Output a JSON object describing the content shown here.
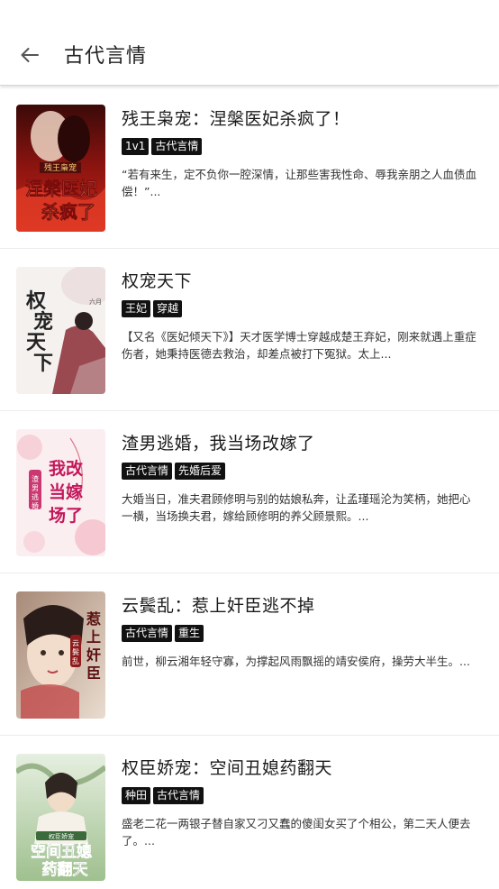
{
  "header": {
    "title": "古代言情",
    "back_icon": "arrow-left-icon"
  },
  "books": [
    {
      "title": "残王枭宠：涅槃医妃杀疯了！",
      "tags": [
        "1v1",
        "古代言情"
      ],
      "description": "“若有来生，定不负你一腔深情，让那些害我性命、辱我亲朋之人血债血偿！”...",
      "cover": {
        "top": "残王枭宠",
        "main": "涅槃医妃",
        "sub": "杀疯了",
        "bg": "#7a0c0c"
      }
    },
    {
      "title": "权宠天下",
      "tags": [
        "王妃",
        "穿越"
      ],
      "description": "【又名《医妃倾天下》】天才医学博士穿越成楚王弃妃，刚来就遇上重症伤者，她秉持医德去救治，却差点被打下冤狱。太上...",
      "cover": {
        "main": "权宠天下",
        "author": "六月",
        "bg": "#f4f1ef"
      }
    },
    {
      "title": "渣男逃婚，我当场改嫁了",
      "tags": [
        "古代言情",
        "先婚后爱"
      ],
      "description": "大婚当日，准夫君顾修明与别的姑娘私奔，让孟瑾瑶沦为笑柄，她把心一横，当场换夫君，嫁给顾修明的养父顾景熙。...",
      "cover": {
        "main": "我当场改嫁了",
        "sub": "渣男逃婚",
        "bg": "#fbeef0"
      }
    },
    {
      "title": "云鬓乱：惹上奸臣逃不掉",
      "tags": [
        "古代言情",
        "重生"
      ],
      "description": "前世，柳云湘年轻守寡，为撑起风雨飘摇的靖安侯府，操劳大半生。...",
      "cover": {
        "main": "惹上奸臣",
        "sub": "云鬓乱",
        "bg": "#d9c6b8"
      }
    },
    {
      "title": "权臣娇宠：空间丑媳药翻天",
      "tags": [
        "种田",
        "古代言情"
      ],
      "description": "盛老二花一两银子替自家又刁又蠢的傻闺女买了个相公，第二天人便去了。...",
      "cover": {
        "main": "空间丑媳",
        "sub": "药翻天",
        "top": "权臣娇宠",
        "bg": "#cfe0c8"
      }
    }
  ]
}
